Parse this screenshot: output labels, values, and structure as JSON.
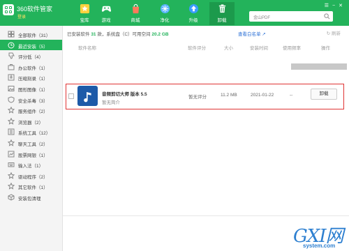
{
  "header": {
    "brand": "360软件管家",
    "login": "登录",
    "search_placeholder": "金山PDF",
    "nav": [
      {
        "label": "宝库",
        "icon": "star-icon"
      },
      {
        "label": "游戏",
        "icon": "gamepad-icon"
      },
      {
        "label": "商城",
        "icon": "shopping-bag-icon"
      },
      {
        "label": "净化",
        "icon": "clean-icon"
      },
      {
        "label": "升级",
        "icon": "upgrade-arrow-icon"
      },
      {
        "label": "卸载",
        "icon": "trash-icon"
      }
    ],
    "active_nav": "卸载"
  },
  "sidebar": {
    "items": [
      {
        "label": "全部软件（31）",
        "icon": "grid-icon"
      },
      {
        "label": "最近安装（5）",
        "icon": "clock-icon",
        "active": true
      },
      {
        "label": "评分低（4）",
        "icon": "thumb-down-icon"
      },
      {
        "label": "办公软件（1）",
        "icon": "briefcase-icon"
      },
      {
        "label": "压缩刻录（1）",
        "icon": "compress-icon"
      },
      {
        "label": "图形图像（1）",
        "icon": "image-icon"
      },
      {
        "label": "安全杀毒（3）",
        "icon": "shield-icon"
      },
      {
        "label": "服务组件（2）",
        "icon": "star-outline-icon"
      },
      {
        "label": "浏览器（2）",
        "icon": "star-outline-icon"
      },
      {
        "label": "系统工具（12）",
        "icon": "tools-icon"
      },
      {
        "label": "聊天工具（2）",
        "icon": "star-outline-icon"
      },
      {
        "label": "股票网银（1）",
        "icon": "chart-icon"
      },
      {
        "label": "输入法（1）",
        "icon": "keyboard-icon"
      },
      {
        "label": "驱动程序（2）",
        "icon": "star-outline-icon"
      },
      {
        "label": "其它软件（1）",
        "icon": "star-outline-icon"
      },
      {
        "label": "安装包清理",
        "icon": "package-icon"
      }
    ]
  },
  "main": {
    "summary_prefix": "已安装软件",
    "summary_count": "31",
    "summary_mid": "款，系统盘（C）可用空间",
    "summary_space": "20.2 GB",
    "whitelist_link": "查看白名单 ↗",
    "refresh": "刷新",
    "columns": {
      "name": "软件名称",
      "rating": "软件评分",
      "size": "大小",
      "install_time": "安装时间",
      "use_freq": "使用频率",
      "action": "操作"
    },
    "rows": [
      {
        "name": "音频剪切大师 版本 5.5",
        "desc": "暂无简介",
        "rating": "暂无评分",
        "size": "11.2 MB",
        "install_time": "2021-01-22",
        "use_freq": "--",
        "action": "卸载"
      }
    ]
  },
  "watermark": {
    "logo": "GXI网",
    "site": "system.com"
  },
  "colors": {
    "brand_green": "#23b35b",
    "active_nav_bg": "#1c9a4c",
    "highlight_border": "#e03333",
    "link_blue": "#2a6fd6",
    "app_icon_bg": "#1d5aa8"
  }
}
